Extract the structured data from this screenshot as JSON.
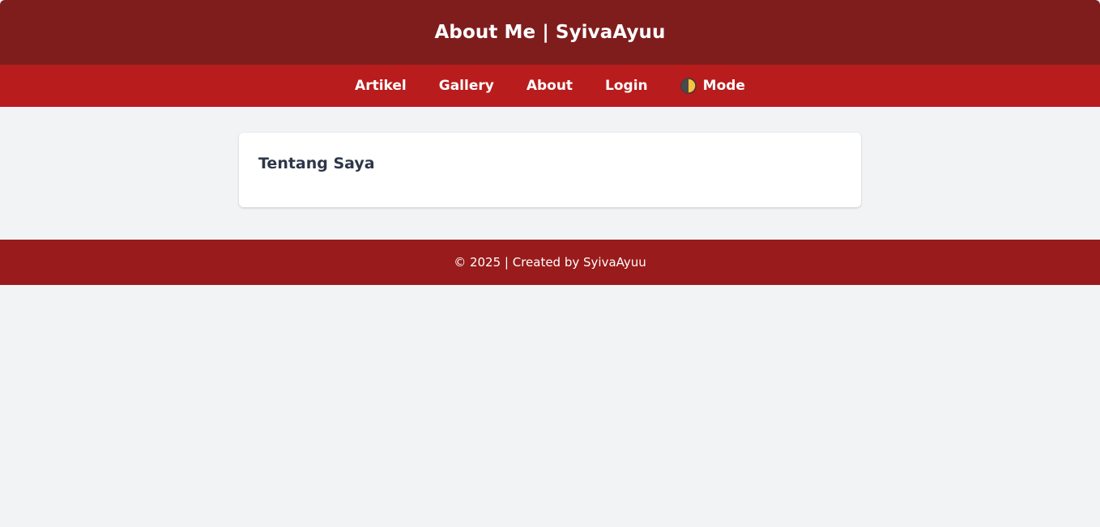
{
  "header": {
    "title": "About Me | SyivaAyuu"
  },
  "nav": {
    "items": [
      {
        "label": "Artikel"
      },
      {
        "label": "Gallery"
      },
      {
        "label": "About"
      },
      {
        "label": "Login"
      }
    ],
    "mode": {
      "label": "Mode",
      "icon": "half-moon-toggle-icon"
    }
  },
  "main": {
    "card_title": "Tentang Saya"
  },
  "footer": {
    "text": "© 2025 | Created by SyivaAyuu"
  },
  "colors": {
    "header_bg": "#7f1d1d",
    "nav_bg": "#b91c1c",
    "footer_bg": "#991b1b",
    "page_bg": "#f2f3f5",
    "card_bg": "#ffffff",
    "card_title": "#2d3748"
  }
}
